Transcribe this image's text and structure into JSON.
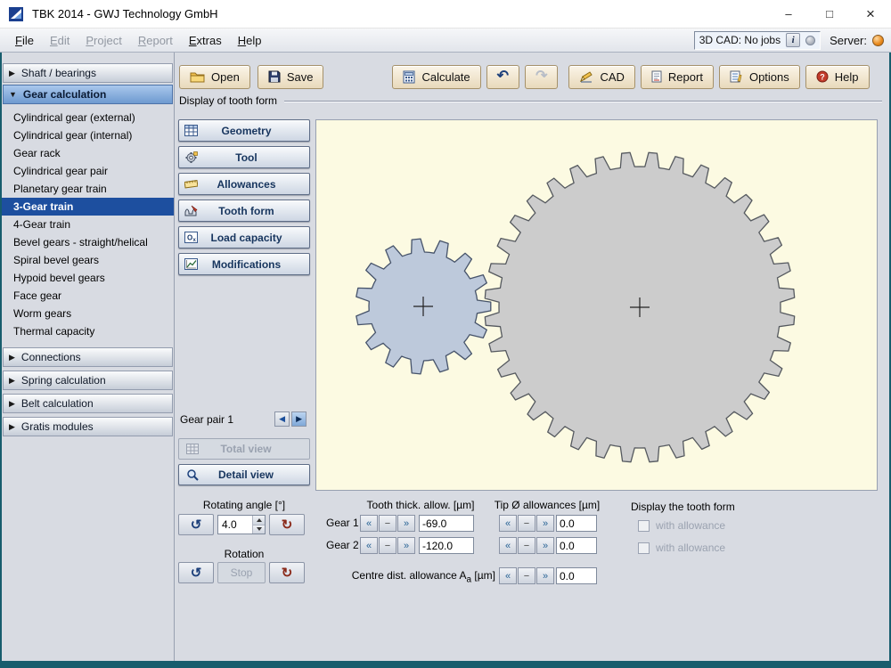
{
  "window": {
    "title": "TBK 2014 - GWJ Technology GmbH",
    "minimize": "–",
    "maximize": "□",
    "close": "×"
  },
  "menu": {
    "items": [
      {
        "label": "File"
      },
      {
        "label": "Edit"
      },
      {
        "label": "Project"
      },
      {
        "label": "Report"
      },
      {
        "label": "Extras"
      },
      {
        "label": "Help"
      }
    ],
    "cad_status": "3D CAD: No jobs",
    "info_label": "i",
    "server_label": "Server:"
  },
  "toolbar": {
    "open": "Open",
    "save": "Save",
    "calculate": "Calculate",
    "undo_icon": "↶",
    "redo_icon": "↷",
    "cad": "CAD",
    "report": "Report",
    "options": "Options",
    "help": "Help"
  },
  "sidebar": {
    "arrow_collapsed": "▶",
    "arrow_expanded": "▼",
    "sections": [
      "Shaft / bearings",
      "Gear calculation",
      "Connections",
      "Spring calculation",
      "Belt calculation",
      "Gratis modules"
    ],
    "gear_items": [
      "Cylindrical gear (external)",
      "Cylindrical gear (internal)",
      "Gear rack",
      "Cylindrical gear pair",
      "Planetary gear train",
      "3-Gear train",
      "4-Gear train",
      "Bevel gears - straight/helical",
      "Spiral bevel gears",
      "Hypoid bevel gears",
      "Face gear",
      "Worm gears",
      "Thermal capacity"
    ],
    "selected_item": "3-Gear train"
  },
  "main": {
    "section_title": "Display of tooth form",
    "panel_buttons": [
      "Geometry",
      "Tool",
      "Allowances",
      "Tooth form",
      "Load capacity",
      "Modifications"
    ],
    "gear_pair_label": "Gear pair 1",
    "pair_prev": "◀",
    "pair_next": "▶",
    "total_view": "Total view",
    "detail_view": "Detail view",
    "rotating_angle_label": "Rotating angle [°]",
    "rotating_angle_value": "4.0",
    "rotation_label": "Rotation",
    "stop_label": "Stop",
    "rotate_ccw": "↺",
    "rotate_cw": "↻",
    "tooth_thick_header": "Tooth thick. allow. [µm]",
    "tip_header": "Tip Ø allowances [µm]",
    "gear1_label": "Gear 1",
    "gear2_label": "Gear 2",
    "values": {
      "gear1_tooth_thick": "-69.0",
      "gear2_tooth_thick": "-120.0",
      "gear1_tip": "0.0",
      "gear2_tip": "0.0",
      "centre_dist": "0.0"
    },
    "centre_label_main": "Centre dist. allowance A",
    "centre_label_sub": "a",
    "centre_label_unit": " [µm]",
    "display_tooth_form": "Display the tooth form",
    "with_allowance": "with allowance",
    "stepper": {
      "dec": "«",
      "mid": "−",
      "inc": "»"
    }
  },
  "canvas": {
    "background": "#fcfae2",
    "gears": [
      {
        "name": "gear-1",
        "teeth": 15,
        "fill": "#bdc9db"
      },
      {
        "name": "gear-2",
        "teeth": 36,
        "fill": "#cccccc"
      }
    ]
  }
}
